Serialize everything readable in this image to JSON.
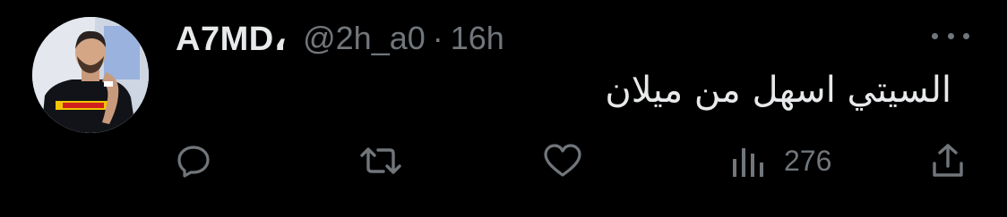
{
  "tweet": {
    "author": {
      "display_name": "A7MD،",
      "handle": "@2h_a0",
      "avatar_icon": "profile-avatar"
    },
    "separator": "·",
    "time": "16h",
    "text": "السيتي اسهل من ميلان",
    "more_icon": "more-dots-icon"
  },
  "actions": {
    "reply_icon": "reply-icon",
    "retweet_icon": "retweet-icon",
    "like_icon": "like-heart-icon",
    "views_icon": "views-bar-chart-icon",
    "views_count": "276",
    "share_icon": "share-icon"
  },
  "colors": {
    "background": "#000000",
    "primary_text": "#e7e9ea",
    "secondary_text": "#71767b"
  }
}
